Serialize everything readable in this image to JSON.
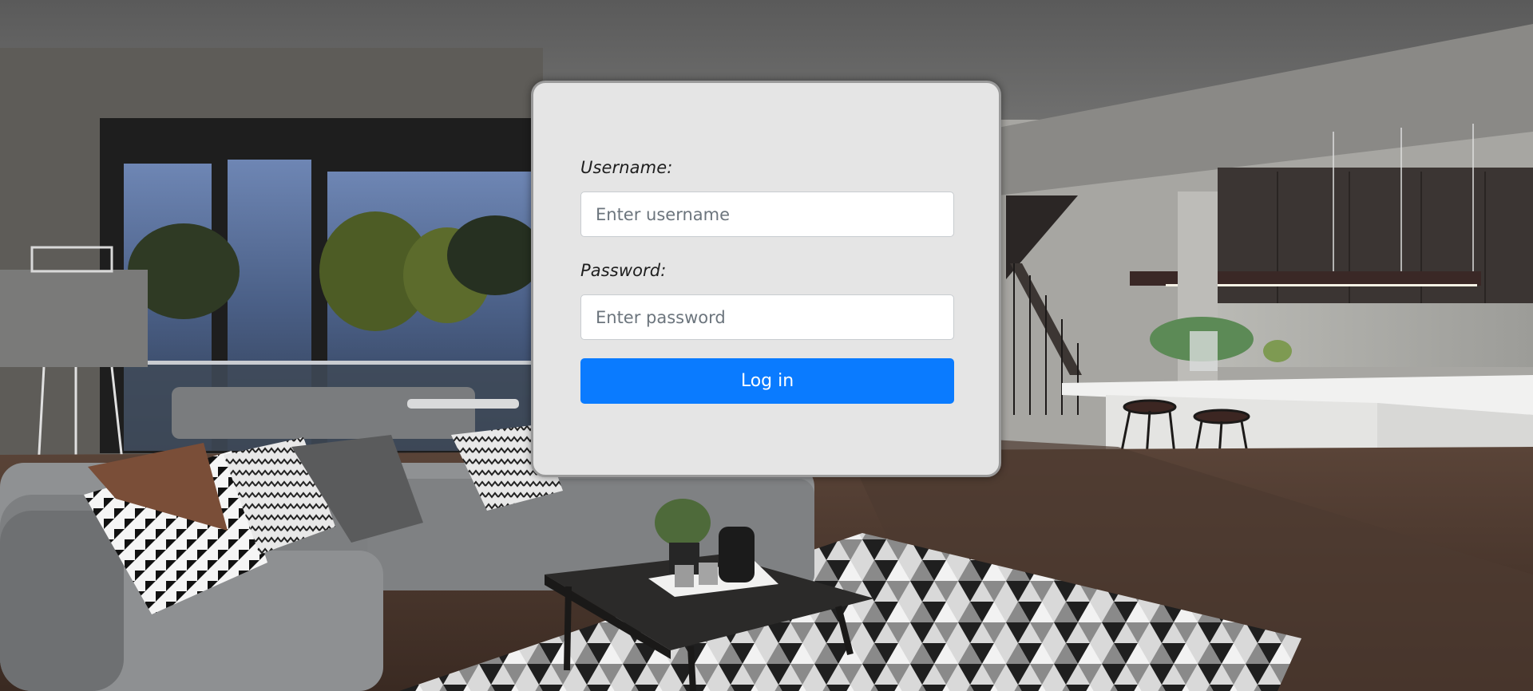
{
  "login_form": {
    "username_label": "Username:",
    "username_placeholder": "Enter username",
    "username_value": "",
    "password_label": "Password:",
    "password_placeholder": "Enter password",
    "password_value": "",
    "submit_label": "Log in"
  },
  "background": {
    "subject": "living-room-kitchen-interior-photo"
  },
  "colors": {
    "card_background": "#e5e5e5",
    "card_border": "#9a9a9a",
    "button_primary": "#0a7bff",
    "button_text": "#ffffff",
    "label_text": "#1e1e1e",
    "placeholder_text": "#6c757d"
  }
}
